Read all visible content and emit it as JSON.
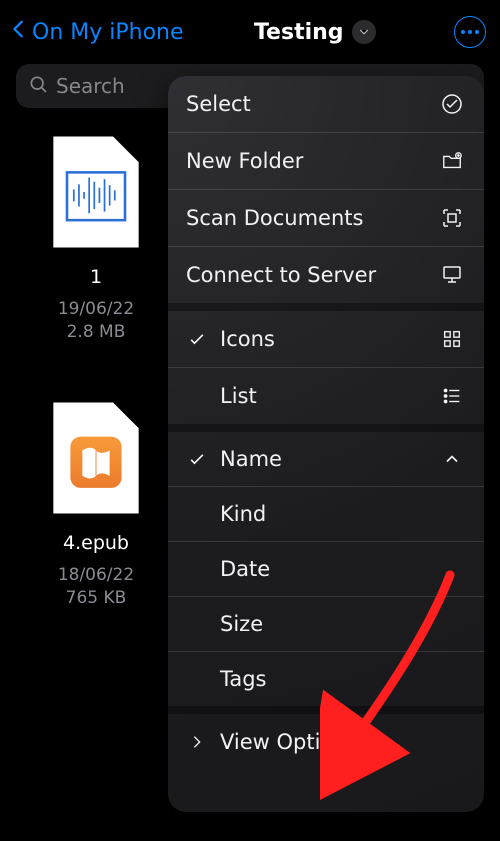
{
  "header": {
    "back_label": "On My iPhone",
    "title": "Testing"
  },
  "search": {
    "placeholder": "Search"
  },
  "files": [
    {
      "name": "1",
      "date": "19/06/22",
      "size": "2.8 MB"
    },
    {
      "name": "4.epub",
      "date": "18/06/22",
      "size": "765 KB"
    }
  ],
  "context_menu": {
    "actions": {
      "select": "Select",
      "new_folder": "New Folder",
      "scan_documents": "Scan Documents",
      "connect_server": "Connect to Server"
    },
    "layout": {
      "icons": "Icons",
      "list": "List"
    },
    "sort": {
      "name": "Name",
      "kind": "Kind",
      "date": "Date",
      "size": "Size",
      "tags": "Tags"
    },
    "view_options": "View Options"
  }
}
